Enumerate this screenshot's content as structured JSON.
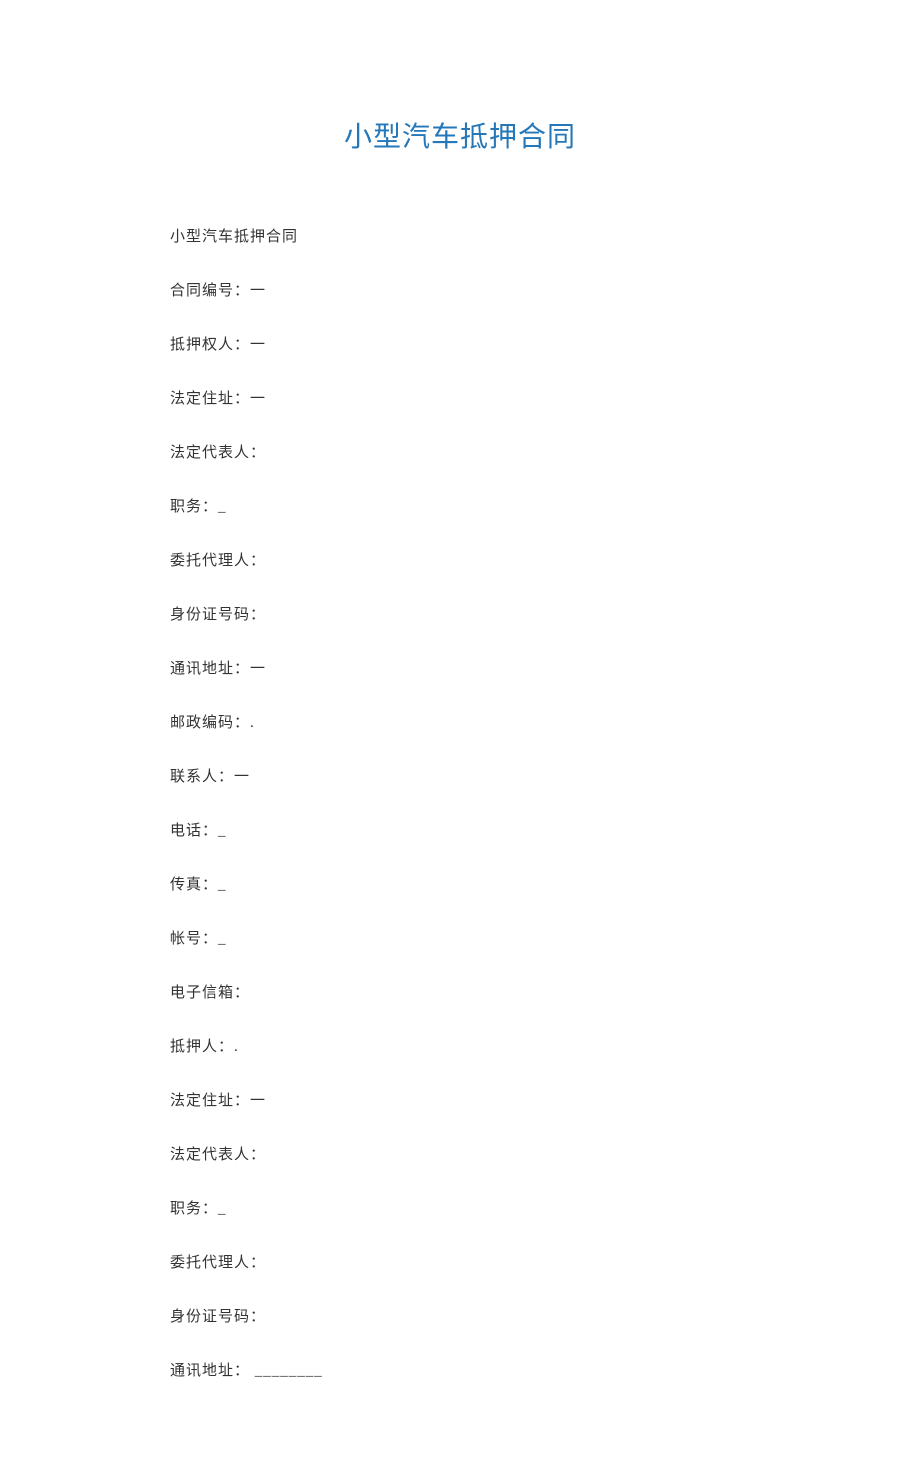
{
  "title": "小型汽车抵押合同",
  "lines": [
    "小型汽车抵押合同",
    "合同编号：一",
    "抵押权人：一",
    "法定住址：一",
    "法定代表人：",
    "职务：_",
    "委托代理人：",
    "身份证号码：",
    "通讯地址：一",
    "邮政编码：.",
    "联系人：一",
    "电话：_",
    "传真：_",
    "帐号：_",
    "电子信箱：",
    "抵押人：.",
    "法定住址：一",
    "法定代表人：",
    "职务：_",
    "委托代理人：",
    "身份证号码：",
    "通讯地址： ________"
  ]
}
